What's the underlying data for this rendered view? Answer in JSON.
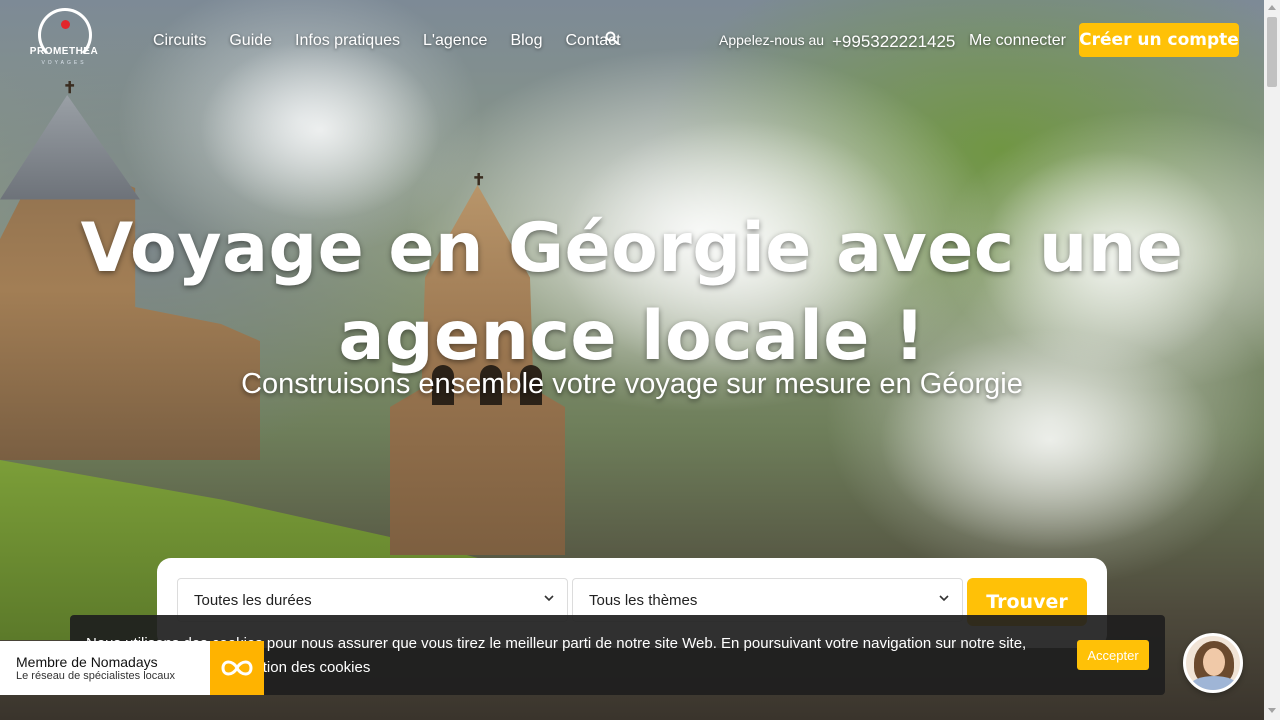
{
  "brand": {
    "name": "PROMETHEA",
    "tagline": "VOYAGES"
  },
  "nav": {
    "items": [
      {
        "label": "Circuits"
      },
      {
        "label": "Guide"
      },
      {
        "label": "Infos pratiques"
      },
      {
        "label": "L'agence"
      },
      {
        "label": "Blog"
      },
      {
        "label": "Contact"
      }
    ],
    "search_icon": "search-icon"
  },
  "contact": {
    "call_label": "Appelez-nous au",
    "phone": "+995322221425"
  },
  "account": {
    "login_label": "Me connecter",
    "signup_label": "Créer un compte"
  },
  "hero": {
    "title": "Voyage en Géorgie avec une agence locale !",
    "subtitle": "Construisons ensemble votre voyage sur mesure en Géorgie"
  },
  "search": {
    "duration_value": "Toutes les durées",
    "theme_value": "Tous les thèmes",
    "submit_label": "Trouver"
  },
  "cookie_banner": {
    "text": "Nous utilisons des cookies pour nous assurer que vous tirez le meilleur parti de notre site Web. En poursuivant votre navigation sur notre site, vous acceptez notre utilisation des cookies",
    "accept_label": "Accepter"
  },
  "badge": {
    "title": "Membre de Nomadays",
    "subtitle": "Le réseau de spécialistes locaux"
  },
  "colors": {
    "accent": "#ffc107",
    "brand_red": "#e2262b",
    "cookie_bg": "#1e1e1e"
  }
}
